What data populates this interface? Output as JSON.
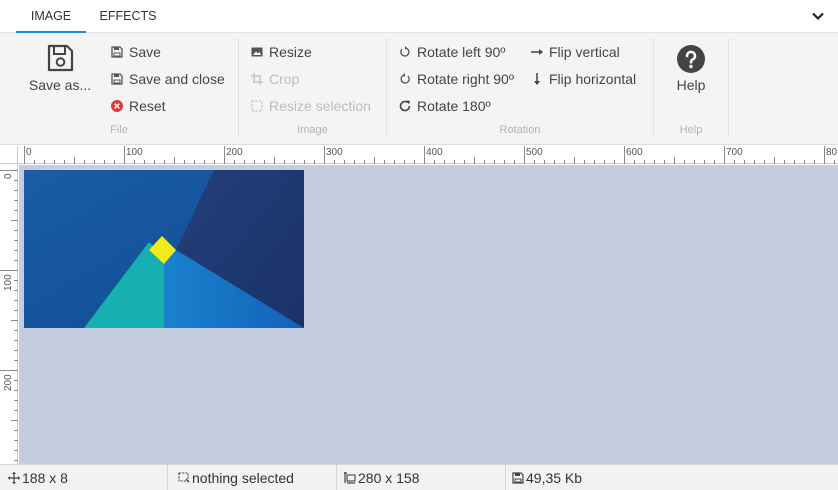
{
  "tabs": [
    {
      "label": "IMAGE",
      "active": true
    },
    {
      "label": "EFFECTS",
      "active": false
    }
  ],
  "ribbon": {
    "file": {
      "label": "File",
      "save_as": "Save as...",
      "save": "Save",
      "save_close": "Save and close",
      "reset": "Reset"
    },
    "image": {
      "label": "Image",
      "resize": "Resize",
      "crop": "Crop",
      "resize_selection": "Resize selection"
    },
    "rotation": {
      "label": "Rotation",
      "rotate_left": "Rotate left 90º",
      "rotate_right": "Rotate right 90º",
      "rotate_180": "Rotate 180º",
      "flip_vertical": "Flip vertical",
      "flip_horizontal": "Flip horizontal"
    },
    "help": {
      "label": "Help",
      "button": "Help"
    }
  },
  "ruler": {
    "top": [
      "0",
      "100",
      "200",
      "300",
      "400",
      "500",
      "600",
      "700",
      "80"
    ],
    "left": [
      "0",
      "100",
      "200"
    ]
  },
  "status": {
    "cursor": "188 x 8",
    "selection": "nothing selected",
    "size": "280 x 158",
    "filesize": "49,35 Kb"
  },
  "colors": {
    "accent": "#1e88e5",
    "canvas": "#c5cedf",
    "reset_icon": "#e53935"
  }
}
